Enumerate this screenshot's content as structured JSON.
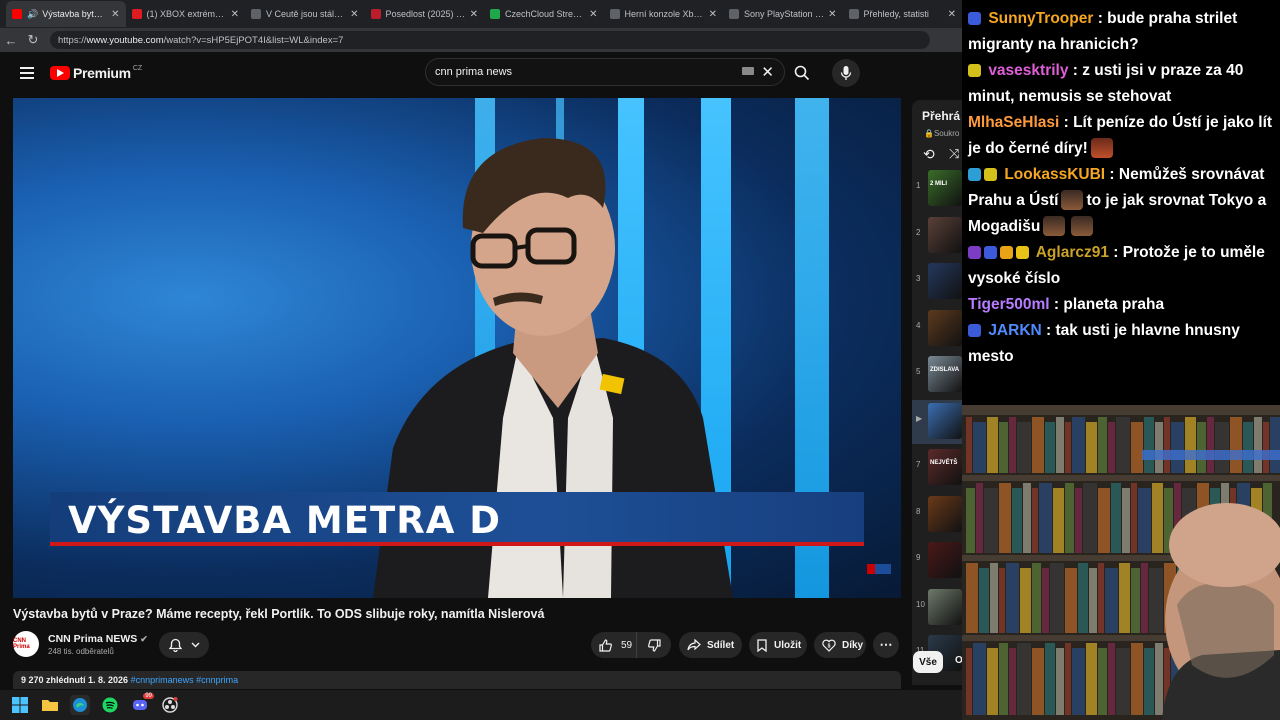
{
  "browser": {
    "tabs": [
      {
        "label": "Výstavba bytů v Praz",
        "active": true,
        "favicon_color": "#ff0000"
      },
      {
        "label": "(1) XBOX extrémně zdra",
        "active": false,
        "favicon_color": "#e01b22"
      },
      {
        "label": "V Ceutě jsou stále tisíce",
        "active": false,
        "favicon_color": "#5f6368"
      },
      {
        "label": "Posedlost (2025) | ČSFD",
        "active": false,
        "favicon_color": "#ba1e2d"
      },
      {
        "label": "CzechCloud Stream - Wi",
        "active": false,
        "favicon_color": "#1fa84a"
      },
      {
        "label": "Herní konzole Xbox Seri",
        "active": false,
        "favicon_color": "#5f6368"
      },
      {
        "label": "Sony PlayStation 4 Slim",
        "active": false,
        "favicon_color": "#5f6368"
      },
      {
        "label": "Přehledy, statisti",
        "active": false,
        "favicon_color": "#5f6368"
      }
    ],
    "url_prefix": "https://",
    "url_host": "www.youtube.com",
    "url_path": "/watch?v=sHP5EjPOT4I&list=WL&index=7"
  },
  "youtube": {
    "logo_word": "Premium",
    "country": "CZ",
    "search_value": "cnn prima news"
  },
  "video": {
    "lower_third": "VÝSTAVBA METRA D",
    "title": "Výstavba bytů v Praze? Máme recepty, řekl Portlík. To ODS slibuje roky, namítla Nislerová",
    "channel_logo": "CNN Prima",
    "channel_name": "CNN Prima NEWS",
    "subscribers": "248 tis. odběratelů",
    "likes": "59",
    "share_label": "Sdílet",
    "save_label": "Uložit",
    "thanks_label": "Díky",
    "views_date": "9 270 zhlédnutí  1. 8. 2026",
    "hashtags": "#cnnprimanews #cnnprima"
  },
  "playlist": {
    "title": "Přehrá",
    "subtitle": "Soukro",
    "items": [
      {
        "num": "1",
        "color": "#3a6d2a",
        "caption": "2 MILI"
      },
      {
        "num": "2",
        "color": "#5a4038"
      },
      {
        "num": "3",
        "color": "#24385e"
      },
      {
        "num": "4",
        "color": "#5c3a1e"
      },
      {
        "num": "5",
        "color": "#7a8a96",
        "caption": "ZDISLAVA"
      },
      {
        "num": "▶",
        "color": "#3b6fb3"
      },
      {
        "num": "7",
        "color": "#5c2a2a",
        "caption": "NEJVĚTŠ"
      },
      {
        "num": "8",
        "color": "#6b3a1a"
      },
      {
        "num": "9",
        "color": "#4a1818"
      },
      {
        "num": "10",
        "color": "#6e7a6a"
      },
      {
        "num": "11",
        "color": "#2a3a4a"
      }
    ],
    "chip_label": "Vše",
    "chip2": "O"
  },
  "chat": {
    "messages": [
      {
        "user": "SunnyTrooper",
        "color": "#f5a623",
        "badges": [
          "#3b5bdb"
        ],
        "text": "bude praha strilet migranty na hranicich?"
      },
      {
        "user": "vasesktrily",
        "color": "#e05fd8",
        "badges": [
          "#d4c01a"
        ],
        "text": "z usti jsi v praze za 40 minut, nemusis se stehovat"
      },
      {
        "user": "MlhaSeHlasi",
        "color": "#ff9a3c",
        "badges": [],
        "text": "Lít peníze do Ústí je jako lít je do černé díry!",
        "emotes_after": 1
      },
      {
        "user": "LookassKUBI",
        "color": "#f5a623",
        "badges": [
          "#2e9fd6",
          "#d4c01a"
        ],
        "text_a": "Nemůžeš srovnávat Prahu a Ústí",
        "text_b": "to je jak srovnat Tokyo a Mogadišu"
      },
      {
        "user": "Aglarcz91",
        "color": "#c9a227",
        "badges": [
          "#7c3cc4",
          "#3b5bdb",
          "#e8a317",
          "#e8c217"
        ],
        "text": "Protože je to uměle vysoké číslo"
      },
      {
        "user": "Tiger500ml",
        "color": "#b77cff",
        "badges": [],
        "text": "planeta praha"
      },
      {
        "user": "JARKN",
        "color": "#4f8bff",
        "badges": [
          "#3b5bdb"
        ],
        "text": "tak usti je hlavne hnusny mesto"
      }
    ]
  },
  "taskbar": {
    "notif_count": "99"
  }
}
